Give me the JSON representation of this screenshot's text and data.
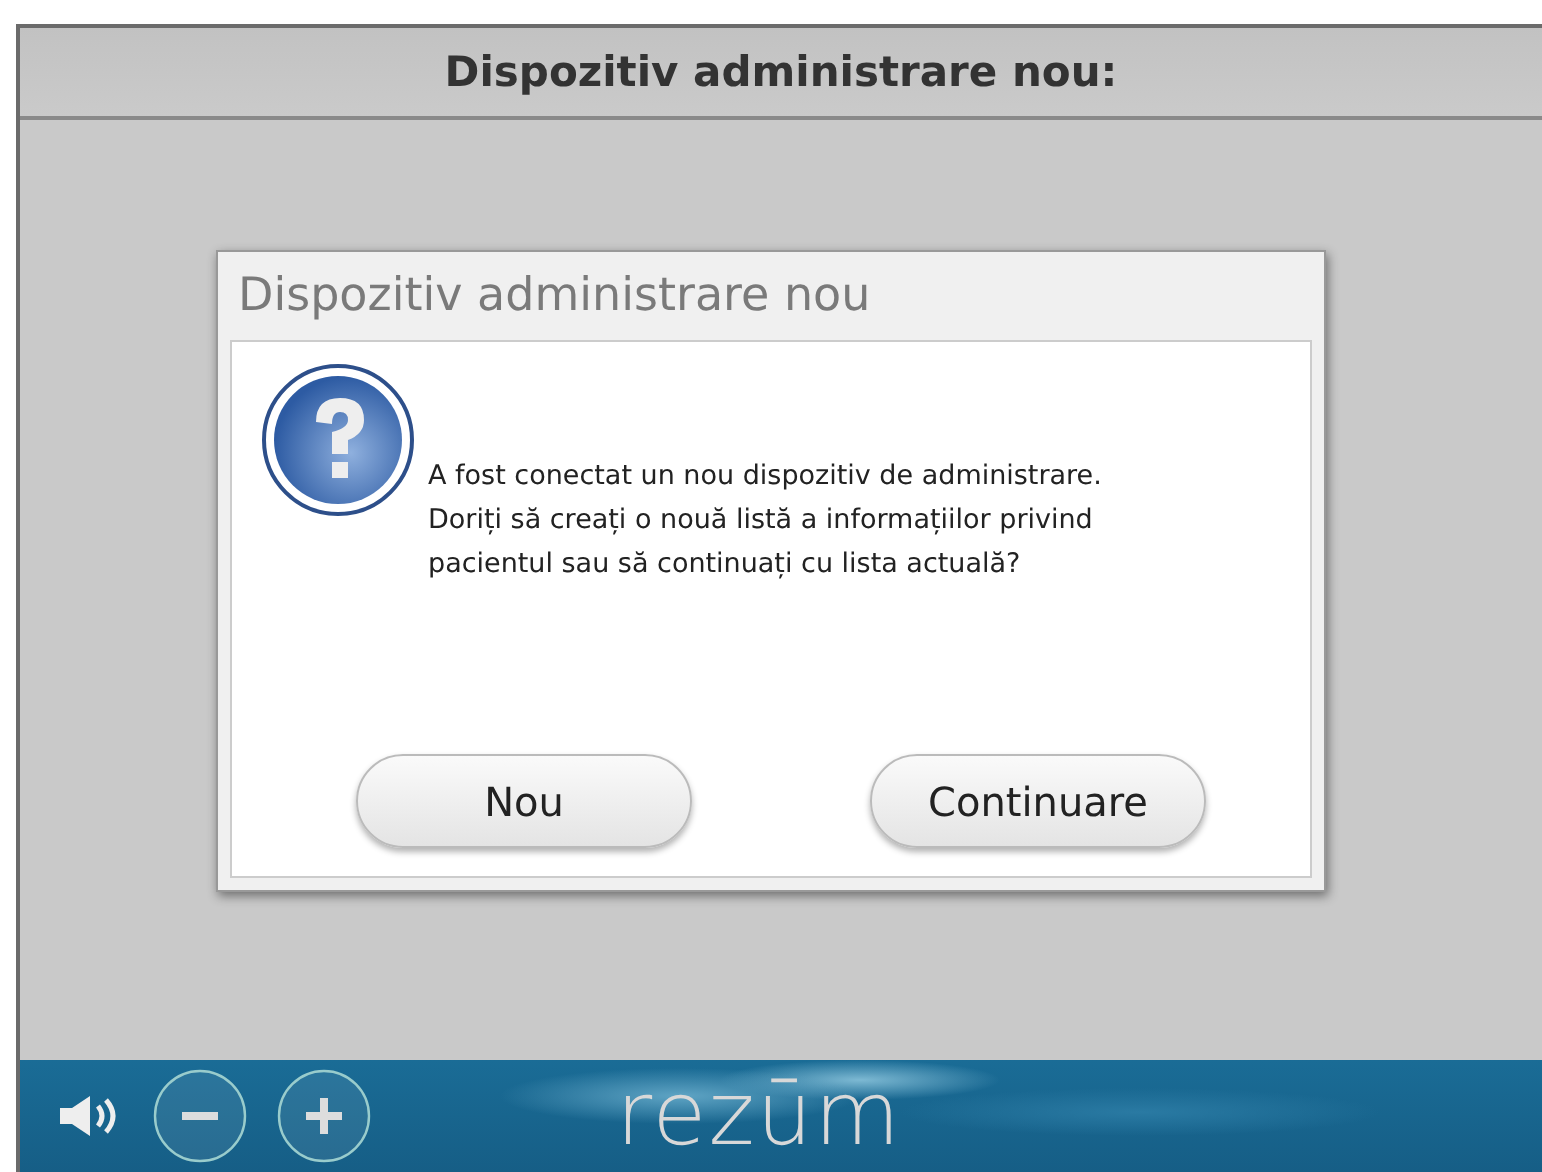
{
  "header": {
    "title": "Dispozitiv administrare nou:"
  },
  "dialog": {
    "title": "Dispozitiv administrare nou",
    "message": "A fost conectat un nou dispozitiv de administrare. Doriți să creați o nouă listă a informațiilor privind pacientul sau să continuați cu lista actuală?",
    "buttons": [
      "Nou",
      "Continuare"
    ]
  },
  "footer": {
    "logo": "rezūm"
  }
}
